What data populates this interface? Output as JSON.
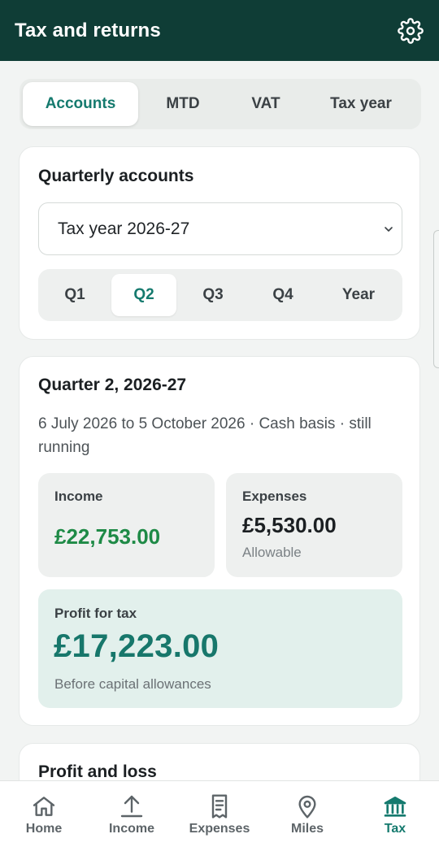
{
  "header": {
    "title": "Tax and returns",
    "settings_icon": "gear-icon"
  },
  "section_tabs": [
    {
      "label": "Accounts",
      "active": true
    },
    {
      "label": "MTD",
      "active": false
    },
    {
      "label": "VAT",
      "active": false
    },
    {
      "label": "Tax year",
      "active": false
    }
  ],
  "quarterly": {
    "title": "Quarterly accounts",
    "tax_year_select": "Tax year 2026-27",
    "quarter_tabs": [
      {
        "label": "Q1",
        "active": false
      },
      {
        "label": "Q2",
        "active": true
      },
      {
        "label": "Q3",
        "active": false
      },
      {
        "label": "Q4",
        "active": false
      },
      {
        "label": "Year",
        "active": false
      }
    ]
  },
  "quarter_summary": {
    "title": "Quarter 2, 2026-27",
    "period": "6 July 2026 to 5 October 2026 · Cash basis · still running",
    "income": {
      "label": "Income",
      "value": "£22,753.00"
    },
    "expenses": {
      "label": "Expenses",
      "value": "£5,530.00",
      "note": "Allowable"
    },
    "profit": {
      "label": "Profit for tax",
      "value": "£17,223.00",
      "note": "Before capital allowances"
    }
  },
  "profit_and_loss": {
    "title": "Profit and loss"
  },
  "bottom_nav": [
    {
      "label": "Home",
      "icon": "home-icon",
      "active": false
    },
    {
      "label": "Income",
      "icon": "upload-arrow-icon",
      "active": false
    },
    {
      "label": "Expenses",
      "icon": "receipt-icon",
      "active": false
    },
    {
      "label": "Miles",
      "icon": "map-pin-icon",
      "active": false
    },
    {
      "label": "Tax",
      "icon": "bank-icon",
      "active": true
    }
  ],
  "colors": {
    "header_bg": "#0f3d36",
    "accent": "#157a6e",
    "income_green": "#1e8a46",
    "profit_bg": "#e2f0ec"
  }
}
